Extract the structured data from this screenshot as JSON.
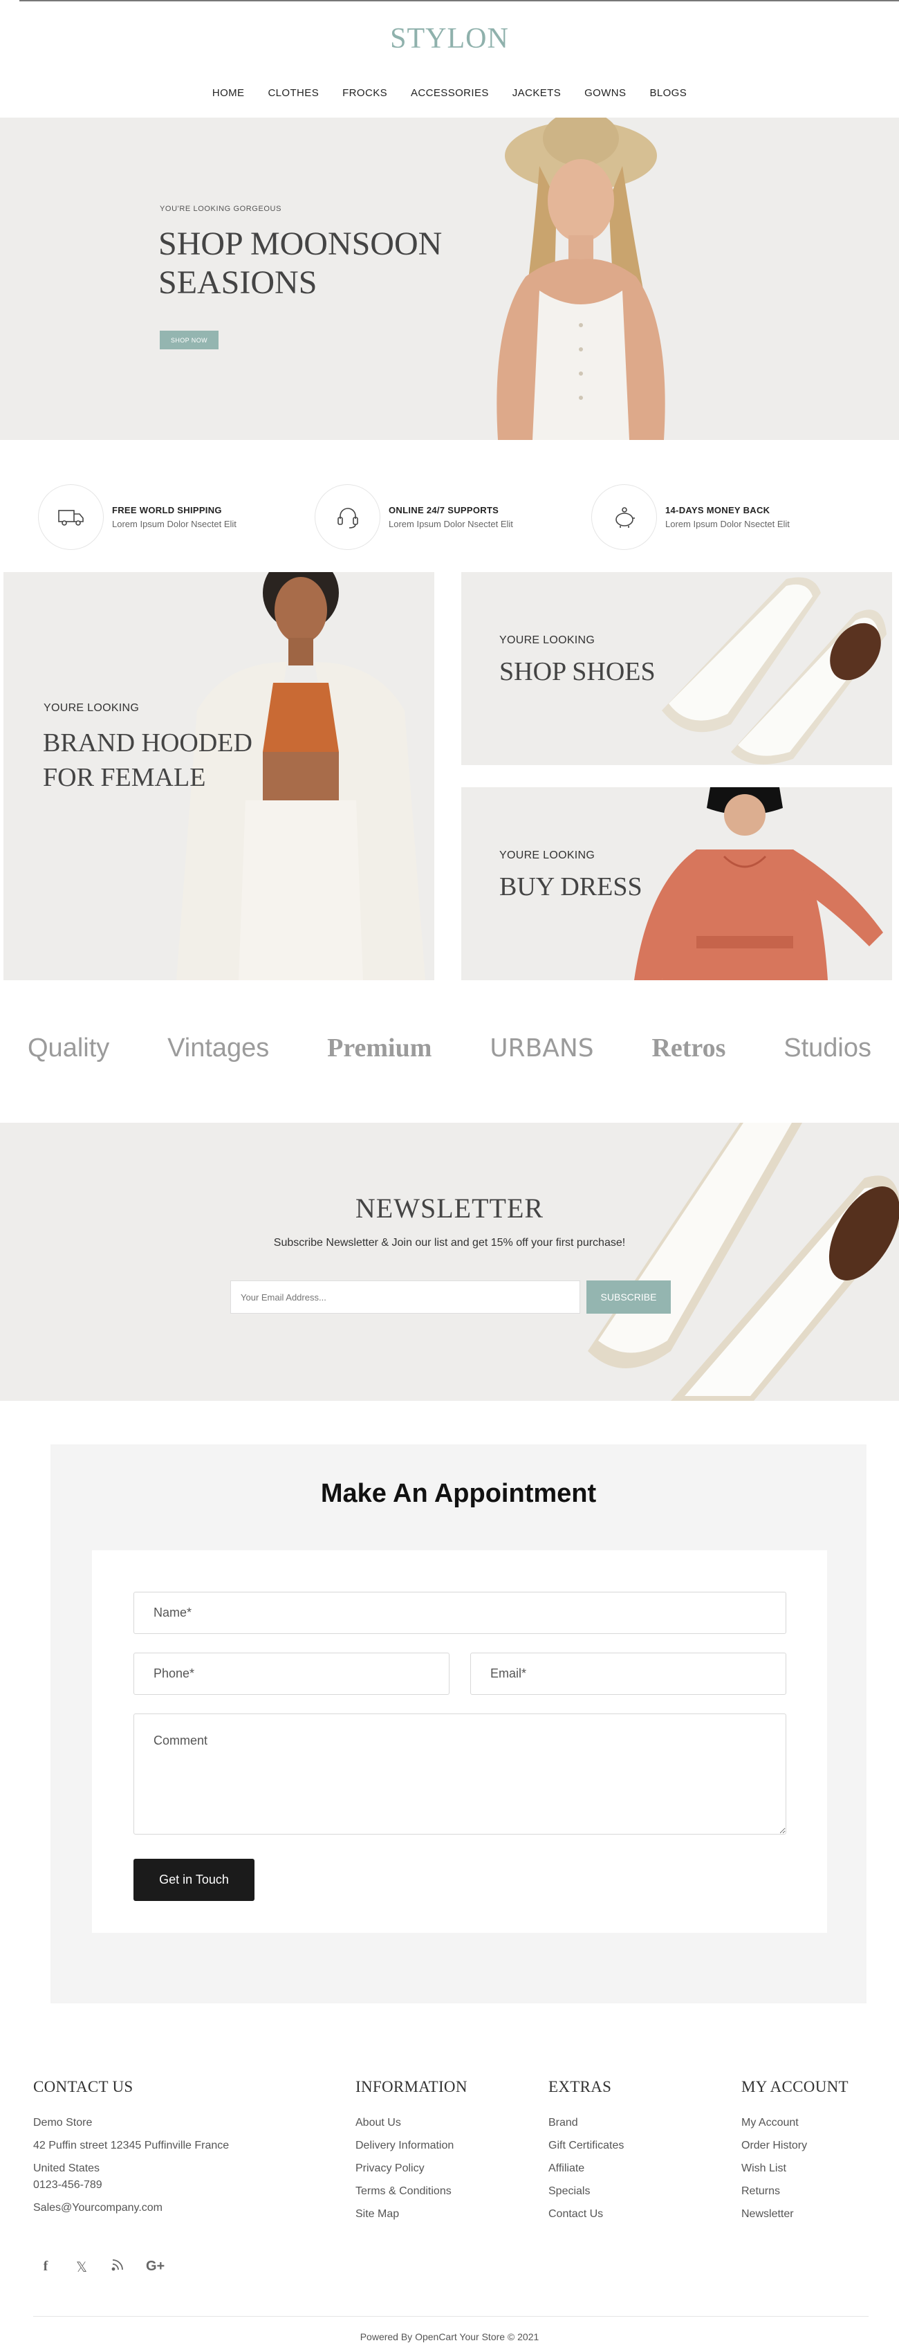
{
  "header": {
    "logo": "STYLON",
    "nav": [
      "HOME",
      "CLOTHES",
      "FROCKS",
      "ACCESSORIES",
      "JACKETS",
      "GOWNS",
      "BLOGS"
    ]
  },
  "hero": {
    "kicker": "YOU'RE LOOKING GORGEOUS",
    "title_line1": "SHOP MOONSOON",
    "title_line2": "SEASIONS",
    "button": "SHOP NOW"
  },
  "features": [
    {
      "icon": "truck-icon",
      "title": "FREE WORLD SHIPPING",
      "subtitle": "Lorem Ipsum Dolor Nsectet Elit"
    },
    {
      "icon": "headset-icon",
      "title": "ONLINE 24/7 SUPPORTS",
      "subtitle": "Lorem Ipsum Dolor Nsectet Elit"
    },
    {
      "icon": "piggy-bank-icon",
      "title": "14-DAYS MONEY BACK",
      "subtitle": "Lorem Ipsum Dolor Nsectet Elit"
    }
  ],
  "banners": {
    "hooded": {
      "kicker": "YOURE LOOKING",
      "title_line1": "BRAND HOODED",
      "title_line2": "FOR FEMALE"
    },
    "shoes": {
      "kicker": "YOURE LOOKING",
      "title": "SHOP SHOES"
    },
    "dress": {
      "kicker": "YOURE LOOKING",
      "title": "BUY DRESS"
    }
  },
  "brands": [
    "Quality",
    "Vintages",
    "Premium",
    "URBANS",
    "Retros",
    "Studios"
  ],
  "newsletter": {
    "title": "NEWSLETTER",
    "subtitle": "Subscribe Newsletter & Join our list and get 15% off your first purchase!",
    "placeholder": "Your Email Address...",
    "button": "SUBSCRIBE"
  },
  "appointment": {
    "title": "Make An Appointment",
    "name_placeholder": "Name*",
    "phone_placeholder": "Phone*",
    "email_placeholder": "Email*",
    "comment_placeholder": "Comment",
    "button": "Get in Touch"
  },
  "footer": {
    "contact": {
      "title": "CONTACT US",
      "store": "Demo Store",
      "address": "42 Puffin street 12345 Puffinville France",
      "country": "United States",
      "phone": "0123-456-789",
      "email": "Sales@Yourcompany.com"
    },
    "information": {
      "title": "INFORMATION",
      "links": [
        "About Us",
        "Delivery Information",
        "Privacy Policy",
        "Terms & Conditions",
        "Site Map"
      ]
    },
    "extras": {
      "title": "EXTRAS",
      "links": [
        "Brand",
        "Gift Certificates",
        "Affiliate",
        "Specials",
        "Contact Us"
      ]
    },
    "account": {
      "title": "MY ACCOUNT",
      "links": [
        "My Account",
        "Order History",
        "Wish List",
        "Returns",
        "Newsletter"
      ]
    },
    "social": [
      "facebook-icon",
      "x-icon",
      "rss-icon",
      "google-plus-icon"
    ],
    "copyright": "Powered By OpenCart Your Store © 2021"
  }
}
